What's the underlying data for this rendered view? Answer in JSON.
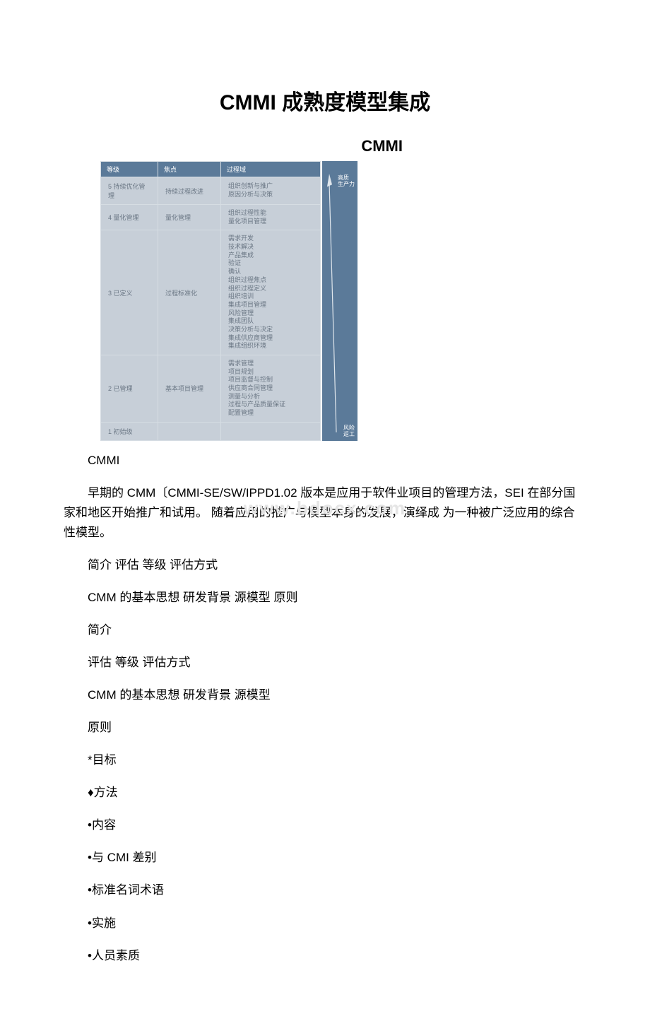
{
  "title": "CMMI 成熟度模型集成",
  "subtitle": "CMMI",
  "diagram": {
    "headers": [
      "等级",
      "焦点",
      "过程域"
    ],
    "rows": [
      {
        "level": "5 持续优化管理",
        "focus": "持续过程改进",
        "areas": "组织创新与推广\n原因分析与决策"
      },
      {
        "level": "4 量化管理",
        "focus": "量化管理",
        "areas": "组织过程性能\n量化项目管理"
      },
      {
        "level": "3 已定义",
        "focus": "过程标准化",
        "areas": "需求开发\n技术解决\n产品集成\n验证\n确认\n组织过程焦点\n组织过程定义\n组织培训\n集成项目管理\n风险管理\n集成团队\n决策分析与决定\n集成供应商管理\n集成组织环境"
      },
      {
        "level": "2 已管理",
        "focus": "基本项目管理",
        "areas": "需求管理\n项目规划\n项目监督与控制\n供应商合同管理\n测量与分析\n过程与产品质量保证\n配置管理"
      },
      {
        "level": "1 初始级",
        "focus": "",
        "areas": ""
      }
    ],
    "arrow_top": "高质\n生产力",
    "arrow_bottom": "风险\n返工"
  },
  "caption": "CMMI",
  "paragraph": "早期的 CMM〔CMMI-SE/SW/IPPD1.02 版本是应用于软件业项目的管理方法，SEI 在部分国家和地区开始推广和试用。 随着应用的推广与模型本身的发展，演绎成 为一种被广泛应用的综合性模型。",
  "lines": [
    "简介 评估 等级 评估方式",
    "CMM 的基本思想 研发背景 源模型 原则",
    "简介",
    "评估 等级 评估方式",
    "CMM 的基本思想 研发背景 源模型",
    "原则",
    "*目标",
    "♦方法",
    "•内容",
    "•与 CMI 差别",
    "•标准名词术语",
    "•实施",
    "•人员素质"
  ],
  "watermark": "www.bdocx.com"
}
